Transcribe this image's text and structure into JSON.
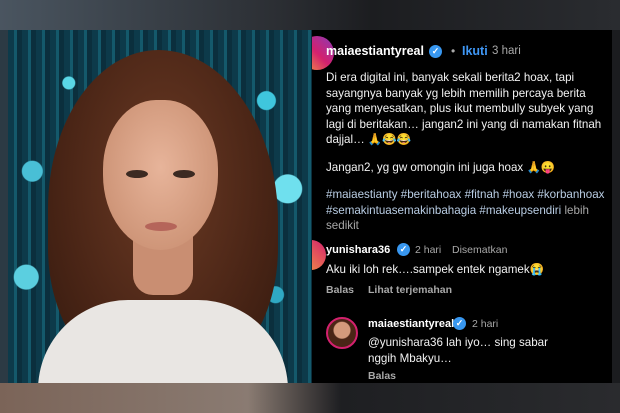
{
  "post": {
    "username": "maiaestiantyreal",
    "separator": "•",
    "follow_label": "Ikuti",
    "time": "3 hari",
    "caption_p1": "Di era digital ini, banyak sekali berita2 hoax, tapi sayangnya banyak yg lebih memilih percaya berita yang menyesatkan, plus ikut membully subyek yang lagi di beritakan… jangan2 ini yang di namakan fitnah dajjal… 🙏😂😂",
    "caption_p2": "Jangan2, yg gw omongin ini juga hoax 🙏😛",
    "hashtags": "#maiaestianty #beritahoax #fitnah #hoax #korbanhoax #semakintuasemakinbahagia #makeupsendiri",
    "more_label": "lebih sedikit"
  },
  "comments": [
    {
      "username": "yunishara36",
      "time": "2 hari",
      "pinned_label": "Disematkan",
      "text": "Aku iki loh rek….sampek entek ngamek😭",
      "reply_label": "Balas",
      "translate_label": "Lihat terjemahan"
    },
    {
      "username": "maiaestiantyreal",
      "time": "2 hari",
      "text": "@yunishara36 lah iyo… sing sabar nggih Mbakyu…",
      "reply_label": "Balas"
    }
  ],
  "icons": {
    "verified": "verified-badge-icon"
  },
  "colors": {
    "background": "#000000",
    "link": "#3f97f5",
    "hashtag": "#b9cde4",
    "muted": "#a8a8a8",
    "verified": "#3897f0"
  }
}
